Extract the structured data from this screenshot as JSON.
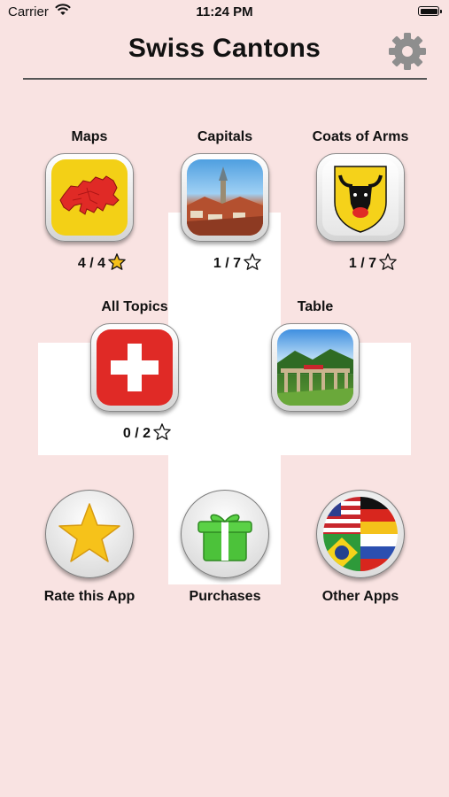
{
  "status_bar": {
    "carrier": "Carrier",
    "time": "11:24 PM"
  },
  "header": {
    "title": "Swiss Cantons",
    "settings_icon": "gear-icon"
  },
  "topics": [
    {
      "label": "Maps",
      "score": "4 / 4",
      "star": "filled",
      "icon": "swiss-map-icon"
    },
    {
      "label": "Capitals",
      "score": "1 / 7",
      "star": "outline",
      "icon": "city-photo-icon"
    },
    {
      "label": "Coats of Arms",
      "score": "1 / 7",
      "star": "outline",
      "icon": "bull-coat-of-arms-icon"
    },
    {
      "label": "All Topics",
      "score": "0 / 2",
      "star": "outline",
      "icon": "swiss-flag-icon"
    },
    {
      "label": "Table",
      "icon": "viaduct-photo-icon"
    }
  ],
  "actions": [
    {
      "label": "Rate this App",
      "icon": "star-icon"
    },
    {
      "label": "Purchases",
      "icon": "gift-icon"
    },
    {
      "label": "Other Apps",
      "icon": "flags-icon"
    }
  ],
  "colors": {
    "background": "#f9e3e2",
    "cross": "#ffffff",
    "swiss_red": "#e02a26",
    "map_yellow": "#f3d016"
  }
}
